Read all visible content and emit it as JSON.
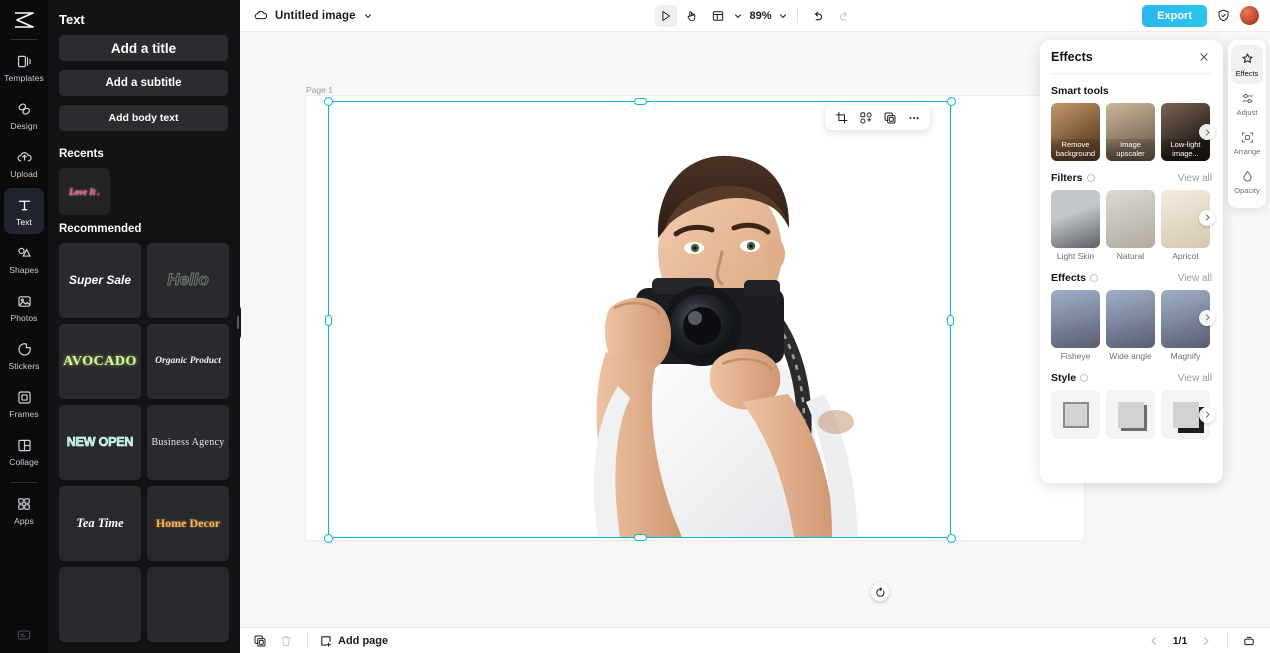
{
  "rail": {
    "logo_icon": "app-logo-icon",
    "items": [
      {
        "label": "Templates",
        "icon": "templates-icon",
        "active": false
      },
      {
        "label": "Design",
        "icon": "design-icon",
        "active": false
      },
      {
        "label": "Upload",
        "icon": "upload-cloud-icon",
        "active": false
      },
      {
        "label": "Text",
        "icon": "text-icon",
        "active": true
      },
      {
        "label": "Shapes",
        "icon": "shapes-icon",
        "active": false
      },
      {
        "label": "Photos",
        "icon": "photos-icon",
        "active": false
      },
      {
        "label": "Stickers",
        "icon": "stickers-icon",
        "active": false
      },
      {
        "label": "Frames",
        "icon": "frames-icon",
        "active": false
      },
      {
        "label": "Collage",
        "icon": "collage-icon",
        "active": false
      },
      {
        "label": "Apps",
        "icon": "apps-grid-icon",
        "active": false
      }
    ],
    "bottom_icon": "help-card-icon"
  },
  "panel": {
    "title": "Text",
    "buttons": [
      {
        "label": "Add a title"
      },
      {
        "label": "Add a subtitle"
      },
      {
        "label": "Add body text"
      }
    ],
    "recents_heading": "Recents",
    "recents": [
      {
        "label": "Love It ."
      }
    ],
    "recommended_heading": "Recommended",
    "templates": [
      {
        "label": "Super Sale",
        "style": "s-supersale"
      },
      {
        "label": "Hello",
        "style": "s-hello"
      },
      {
        "label": "AVOCADO",
        "style": "s-avocado"
      },
      {
        "label": "Organic Product",
        "style": "s-organic"
      },
      {
        "label": "NEW OPEN",
        "style": "s-newopen"
      },
      {
        "label": "Business Agency",
        "style": "s-business"
      },
      {
        "label": "Tea Time",
        "style": "s-teatime"
      },
      {
        "label": "Home Decor",
        "style": "s-homedecor"
      },
      {
        "label": "",
        "style": ""
      },
      {
        "label": "",
        "style": ""
      }
    ]
  },
  "topbar": {
    "cloud_icon": "cloud-sync-icon",
    "doc_name": "Untitled image",
    "doc_caret_icon": "chevron-down-icon",
    "select_tool_icon": "cursor-select-icon",
    "hand_tool_icon": "hand-pan-icon",
    "layout_tool_icon": "page-layout-icon",
    "layout_caret_icon": "chevron-down-icon",
    "zoom_level": "89%",
    "zoom_caret_icon": "chevron-down-icon",
    "undo_icon": "undo-arrow-icon",
    "redo_icon": "redo-arrow-icon",
    "export_label": "Export",
    "shield_icon": "shield-check-icon",
    "avatar_name": "user-avatar"
  },
  "canvas": {
    "page_label": "Page 1",
    "float_tools": [
      {
        "icon": "crop-icon"
      },
      {
        "icon": "cutout-icon"
      },
      {
        "icon": "duplicate-icon"
      },
      {
        "icon": "more-options-icon"
      }
    ],
    "rotate_icon": "rotate-handle-icon",
    "selection_color": "#00BCD9",
    "image_alt": "Smiling man holding a DSLR camera"
  },
  "bottombar": {
    "duplicate_page_icon": "duplicate-page-icon",
    "delete_page_icon": "trash-icon",
    "add_page_icon": "add-page-icon",
    "add_page_label": "Add page",
    "prev_page_icon": "chevron-left-icon",
    "page_indicator": "1/1",
    "next_page_icon": "chevron-right-icon",
    "timeline_icon": "timeline-icon"
  },
  "effects_panel": {
    "title": "Effects",
    "close_icon": "close-icon",
    "sections": [
      {
        "heading": "Smart tools",
        "has_info": false,
        "view_all": null,
        "kind": "photo-captioned",
        "items": [
          {
            "caption": "Remove background",
            "c1": "#9a7a58",
            "c2": "#4a3c2c"
          },
          {
            "caption": "Image upscaler",
            "c1": "#b9a991",
            "c2": "#6d6052"
          },
          {
            "caption": "Low-light image...",
            "c1": "#6b5a4e",
            "c2": "#2c2420"
          }
        ]
      },
      {
        "heading": "Filters",
        "has_info": true,
        "view_all": "View all",
        "kind": "photo-below",
        "items": [
          {
            "caption": "Light Skin",
            "c1": "#b7b9bd",
            "c2": "#6d6f74"
          },
          {
            "caption": "Natural",
            "c1": "#d5d2cc",
            "c2": "#b3aea5"
          },
          {
            "caption": "Apricot",
            "c1": "#efe6d7",
            "c2": "#d9cbb4"
          }
        ]
      },
      {
        "heading": "Effects",
        "has_info": true,
        "view_all": "View all",
        "kind": "photo-below",
        "items": [
          {
            "caption": "Fisheye",
            "c1": "#9aabc4",
            "c2": "#5d5f73"
          },
          {
            "caption": "Wide angle",
            "c1": "#9aabc4",
            "c2": "#5d5f73"
          },
          {
            "caption": "Magnify",
            "c1": "#9aabc4",
            "c2": "#5d5f73"
          }
        ]
      },
      {
        "heading": "Style",
        "has_info": true,
        "view_all": "View all",
        "kind": "style",
        "items": [
          {
            "caption": "",
            "variant": "sty-a"
          },
          {
            "caption": "",
            "variant": "sty-b"
          },
          {
            "caption": "",
            "variant": "sty-c"
          }
        ]
      }
    ]
  },
  "effects_rail": {
    "items": [
      {
        "label": "Effects",
        "icon": "effects-sparkle-icon",
        "active": true
      },
      {
        "label": "Adjust",
        "icon": "adjust-sliders-icon",
        "active": false
      },
      {
        "label": "Arrange",
        "icon": "arrange-frame-icon",
        "active": false
      },
      {
        "label": "Opacity",
        "icon": "opacity-drop-icon",
        "active": false
      }
    ]
  }
}
